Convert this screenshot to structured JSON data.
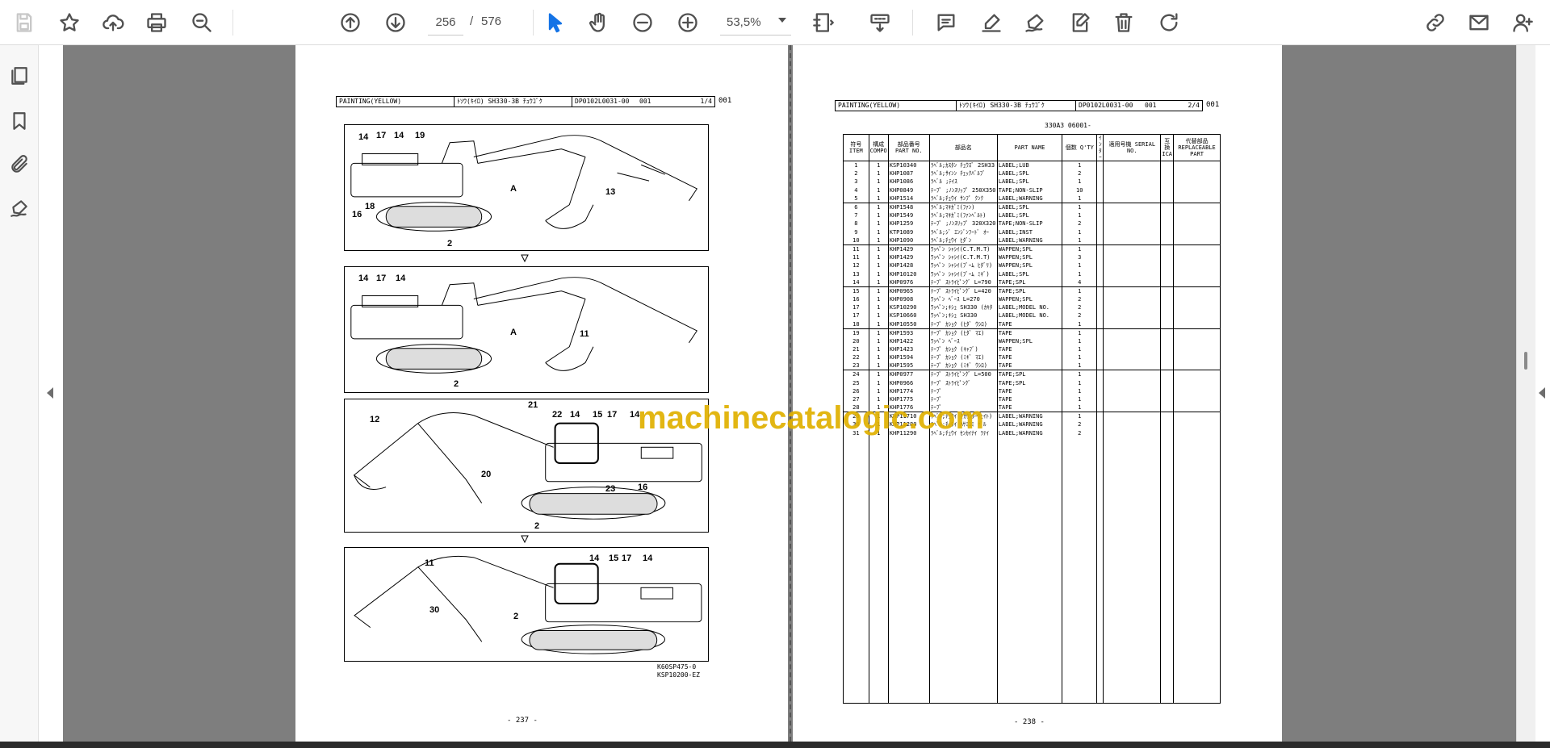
{
  "toolbar": {
    "page_current": "256",
    "page_sep": "/",
    "page_total": "576",
    "zoom": "53,5%"
  },
  "colors": {
    "accent": "#1473e6",
    "watermark": "#e0b000",
    "viewer_bg": "#7e7e7e"
  },
  "watermark": "machinecatalogic.com",
  "left_page": {
    "header": {
      "title": "PAINTING(YELLOW)",
      "model": "ﾄｿｳ(ｷｲﾛ) SH330-3B ﾁｭｳｺﾞｸ",
      "code": "DP0102L0031-00",
      "seq": "001",
      "page": "1/4",
      "suffix": "001"
    },
    "figure_codes": [
      "K60SP475-0",
      "KSP10200-EZ"
    ],
    "page_number": "- 237 -",
    "callouts": [
      {
        "fig": 1,
        "labels": [
          "14",
          "17",
          "14",
          "19",
          "18",
          "16",
          "2",
          "13",
          "A"
        ]
      },
      {
        "fig": 2,
        "labels": [
          "14",
          "17",
          "14",
          "2",
          "11",
          "A"
        ]
      },
      {
        "fig": 3,
        "labels": [
          "12",
          "21",
          "22",
          "14",
          "15",
          "17",
          "14",
          "20",
          "2",
          "23",
          "16"
        ]
      },
      {
        "fig": 4,
        "labels": [
          "11",
          "14",
          "15",
          "17",
          "14",
          "30",
          "2"
        ]
      }
    ]
  },
  "right_page": {
    "header": {
      "title": "PAINTING(YELLOW)",
      "model": "ﾄｿｳ(ｷｲﾛ) SH330-3B ﾁｭｳｺﾞｸ",
      "code": "DP0102L0031-00",
      "seq": "001",
      "page": "2/4",
      "suffix": "001"
    },
    "serial_range": "330A3 06001-",
    "page_number": "- 238 -",
    "columns": [
      "符号 ITEM",
      "構成 COMPO",
      "部品番号 PART NO.",
      "部品名",
      "PART NAME",
      "個数 Q'TY",
      "ｲﾝﾀｰ",
      "適用号機 SERIAL NO.",
      "互換 ICA",
      "代替部品 REPLACEABLE PART"
    ],
    "rows": [
      {
        "item": "1",
        "compo": "1",
        "part_no": "KSP10340",
        "jp": "ﾗﾍﾞﾙ;ｶｽﾀﾝ ﾁｭｳｽﾞ 2SH33",
        "name": "LABEL;LUB",
        "qty": "1",
        "grp": true
      },
      {
        "item": "2",
        "compo": "1",
        "part_no": "KHP1087",
        "jp": "ﾗﾍﾞﾙ;ｻｲﾝﾝ ﾁｪｯｸﾊﾞﾙﾌﾞ",
        "name": "LABEL;SPL",
        "qty": "2",
        "grp": false
      },
      {
        "item": "3",
        "compo": "1",
        "part_no": "KHP1086",
        "jp": "ﾗﾍﾞﾙ ;ﾃｲｽ",
        "name": "LABEL;SPL",
        "qty": "1",
        "grp": false
      },
      {
        "item": "4",
        "compo": "1",
        "part_no": "KHP0849",
        "jp": "ﾃｰﾌﾟ ;ﾉﾝｽﾘｯﾌﾟ 250X350",
        "name": "TAPE;NON-SLIP",
        "qty": "10",
        "grp": false
      },
      {
        "item": "5",
        "compo": "1",
        "part_no": "KHP1514",
        "jp": "ﾗﾍﾞﾙ;ﾁｭｳｲ ｻﾝﾌﾟ ｸﾝｸ",
        "name": "LABEL;WARNING",
        "qty": "1",
        "grp": false
      },
      {
        "item": "6",
        "compo": "1",
        "part_no": "KHP1548",
        "jp": "ﾗﾍﾞﾙ;ﾏｷｶﾞﾐ(ﾌｧﾝ)",
        "name": "LABEL;SPL",
        "qty": "1",
        "grp": true
      },
      {
        "item": "7",
        "compo": "1",
        "part_no": "KHP1549",
        "jp": "ﾗﾍﾞﾙ;ﾏｷｶﾞﾐ(ﾌｧﾝﾍﾞﾙﾄ)",
        "name": "LABEL;SPL",
        "qty": "1",
        "grp": false
      },
      {
        "item": "8",
        "compo": "1",
        "part_no": "KHP1259",
        "jp": "ﾃｰﾌﾟ ;ﾉﾝｽﾘｯﾌﾟ 320X320",
        "name": "TAPE;NON-SLIP",
        "qty": "2",
        "grp": false
      },
      {
        "item": "9",
        "compo": "1",
        "part_no": "KTP1089",
        "jp": "ﾗﾍﾞﾙ;ｼﾞ ｴﾝｼﾞﾝﾌｰﾄﾞ ｵｰ",
        "name": "LABEL;INST",
        "qty": "1",
        "grp": false
      },
      {
        "item": "10",
        "compo": "1",
        "part_no": "KHP1090",
        "jp": "ﾗﾍﾞﾙ;ﾁｭｳｲ ﾋﾀﾞﾝ",
        "name": "LABEL;WARNING",
        "qty": "1",
        "grp": false
      },
      {
        "item": "11",
        "compo": "1",
        "part_no": "KHP1429",
        "jp": "ﾜｯﾍﾟﾝ ｼｬｼｲ(C.T.M.T)",
        "name": "WAPPEN;SPL",
        "qty": "1",
        "grp": true
      },
      {
        "item": "11",
        "compo": "1",
        "part_no": "KHP1429",
        "jp": "ﾜｯﾍﾟﾝ ｼｬｼｲ(C.T.M.T)",
        "name": "WAPPEN;SPL",
        "qty": "3",
        "grp": false
      },
      {
        "item": "12",
        "compo": "1",
        "part_no": "KHP1428",
        "jp": "ﾜｯﾍﾟﾝ ｼｬｼｲ(ﾌﾞｰﾑ ﾋﾀﾞﾘ)",
        "name": "WAPPEN;SPL",
        "qty": "1",
        "grp": false
      },
      {
        "item": "13",
        "compo": "1",
        "part_no": "KHP10120",
        "jp": "ﾜｯﾍﾟﾝ ｼｬｼｲ(ﾌﾞｰﾑ ﾐｷﾞ)",
        "name": "LABEL;SPL",
        "qty": "1",
        "grp": false
      },
      {
        "item": "14",
        "compo": "1",
        "part_no": "KHP0976",
        "jp": "ﾃｰﾌﾟ ｽﾄﾗｲﾋﾟﾝｸﾞ L=790",
        "name": "TAPE;SPL",
        "qty": "4",
        "grp": false
      },
      {
        "item": "15",
        "compo": "1",
        "part_no": "KHP0965",
        "jp": "ﾃｰﾌﾟ ｽﾄﾗｲﾋﾟﾝｸﾞ L=420",
        "name": "TAPE;SPL",
        "qty": "1",
        "grp": true
      },
      {
        "item": "16",
        "compo": "1",
        "part_no": "KHP0908",
        "jp": "ﾜｯﾍﾟﾝ ﾍﾞｰｽ L=270",
        "name": "WAPPEN;SPL",
        "qty": "2",
        "grp": false
      },
      {
        "item": "17",
        "compo": "1",
        "part_no": "KSP10290",
        "jp": "ﾜｯﾍﾟﾝ;ｷｼｭ SH330 (ｶｷﾀ",
        "name": "LABEL;MODEL NO.",
        "qty": "2",
        "grp": false
      },
      {
        "item": "17",
        "compo": "1",
        "part_no": "KSP10660",
        "jp": "ﾜｯﾍﾟﾝ;ｷｼｭ SH330",
        "name": "LABEL;MODEL NO.",
        "qty": "2",
        "grp": false
      },
      {
        "item": "18",
        "compo": "1",
        "part_no": "KHP10550",
        "jp": "ﾃｰﾌﾟ ｶｼｮｸ (ﾋﾀﾞ ｳｼﾛ)",
        "name": "TAPE",
        "qty": "1",
        "grp": false
      },
      {
        "item": "19",
        "compo": "1",
        "part_no": "KHP1593",
        "jp": "ﾃｰﾌﾟ ｶｼｮｸ (ﾋﾀﾞ ﾏｴ)",
        "name": "TAPE",
        "qty": "1",
        "grp": true
      },
      {
        "item": "20",
        "compo": "1",
        "part_no": "KHP1422",
        "jp": "ﾜｯﾍﾟﾝ ﾍﾞｰｽ",
        "name": "WAPPEN;SPL",
        "qty": "1",
        "grp": false
      },
      {
        "item": "21",
        "compo": "1",
        "part_no": "KHP1423",
        "jp": "ﾃｰﾌﾟ ｶｼｮｸ (ｷｬﾌﾞ)",
        "name": "TAPE",
        "qty": "1",
        "grp": false
      },
      {
        "item": "22",
        "compo": "1",
        "part_no": "KHP1594",
        "jp": "ﾃｰﾌﾟ ｶｼｮｸ (ﾐｷﾞ ﾏｴ)",
        "name": "TAPE",
        "qty": "1",
        "grp": false
      },
      {
        "item": "23",
        "compo": "1",
        "part_no": "KHP1595",
        "jp": "ﾃｰﾌﾟ ｶｼｮｸ (ﾐｷﾞ ｳｼﾛ)",
        "name": "TAPE",
        "qty": "1",
        "grp": false
      },
      {
        "item": "24",
        "compo": "1",
        "part_no": "KHP0977",
        "jp": "ﾃｰﾌﾟ ｽﾄﾗｲﾋﾟﾝｸﾞ L=500",
        "name": "TAPE;SPL",
        "qty": "1",
        "grp": true
      },
      {
        "item": "25",
        "compo": "1",
        "part_no": "KHP0966",
        "jp": "ﾃｰﾌﾟ ｽﾄﾗｲﾋﾟﾝｸﾞ",
        "name": "TAPE;SPL",
        "qty": "1",
        "grp": false
      },
      {
        "item": "26",
        "compo": "1",
        "part_no": "KHP1774",
        "jp": "ﾃｰﾌﾟ",
        "name": "TAPE",
        "qty": "1",
        "grp": false
      },
      {
        "item": "27",
        "compo": "1",
        "part_no": "KHP1775",
        "jp": "ﾃｰﾌﾟ",
        "name": "TAPE",
        "qty": "1",
        "grp": false
      },
      {
        "item": "28",
        "compo": "1",
        "part_no": "KHP1776",
        "jp": "ﾃｰﾌﾟ",
        "name": "TAPE",
        "qty": "1",
        "grp": false
      },
      {
        "item": "29",
        "compo": "1",
        "part_no": "KHP11710",
        "jp": "ﾗﾍﾞﾙ;ﾁｭｳｲ (ｶｳﾝﾀｰｳｪｲﾄ)",
        "name": "LABEL;WARNING",
        "qty": "1",
        "grp": true
      },
      {
        "item": "30",
        "compo": "1",
        "part_no": "KHP11280",
        "jp": "ﾗﾍﾞﾙ;ﾁｭｳｲ ﾊｻﾐｺﾐ ｹﾞﾙ",
        "name": "LABEL;WARNING",
        "qty": "2",
        "grp": false
      },
      {
        "item": "31",
        "compo": "1",
        "part_no": "KHP11290",
        "jp": "ﾗﾍﾞﾙ;ﾁｭｳｲ ｾﾝｶｲﾅｲ ﾗﾃｲ",
        "name": "LABEL;WARNING",
        "qty": "2",
        "grp": false
      }
    ]
  }
}
